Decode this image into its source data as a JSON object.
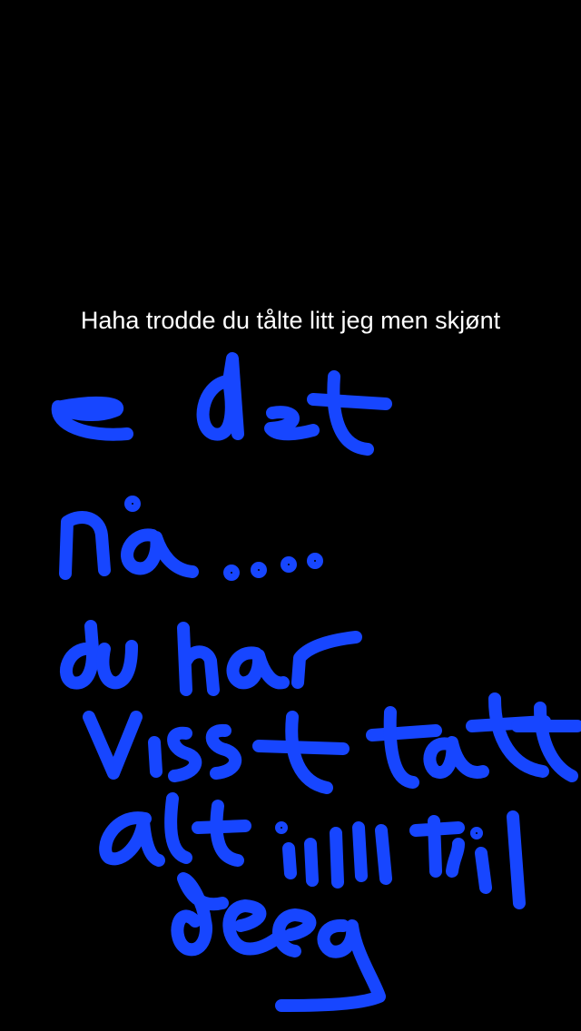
{
  "snap": {
    "caption": "Haha trodde du tålte litt jeg men skjønt",
    "background_color": "#000000",
    "caption_text_color": "#ffffff"
  },
  "drawing": {
    "stroke_color": "#1746ff",
    "handwritten_lines": [
      "e det",
      "nå ....",
      "du har",
      "visst tatt",
      "alt innn til",
      "deg"
    ]
  }
}
